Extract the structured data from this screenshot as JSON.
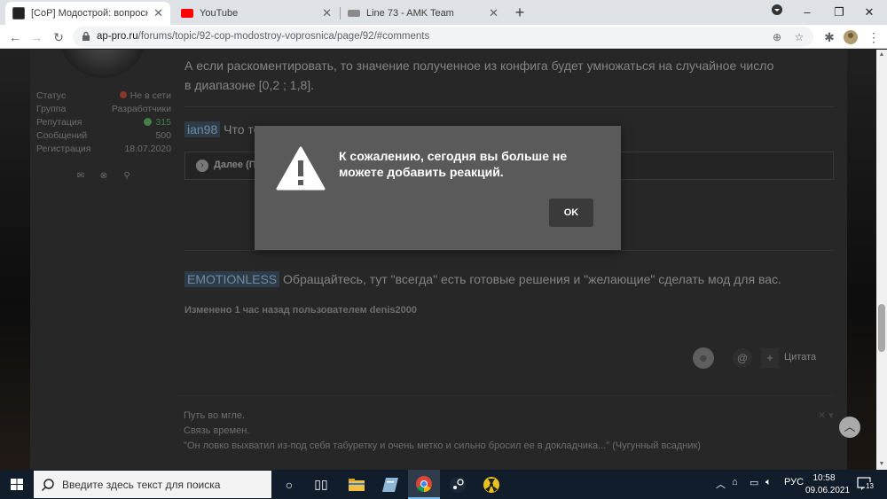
{
  "browser": {
    "tabs": [
      {
        "title": "[CoP] Модострой: вопросница",
        "active": true
      },
      {
        "title": "YouTube",
        "active": false
      },
      {
        "title": "Line 73 - AMK Team",
        "active": false
      }
    ],
    "url_host": "ap-pro.ru",
    "url_path": "/forums/topic/92-cop-modostroy-voprosnica/page/92/#comments",
    "window_controls": [
      "–",
      "❐",
      "✕"
    ]
  },
  "profile": {
    "stats": [
      {
        "key": "Статус",
        "value": "Не в сети"
      },
      {
        "key": "Группа",
        "value": "Разработчики"
      },
      {
        "key": "Репутация",
        "value": "315"
      },
      {
        "key": "Сообщений",
        "value": "500"
      },
      {
        "key": "Регистрация",
        "value": "18.07.2020"
      }
    ]
  },
  "post": {
    "line1": "А если раскоментировать, то значение полученное из конфига будет умножаться на случайное число",
    "line2": "в диапазоне [0,2 ; 1,8].",
    "mention1": "ian98",
    "mention1_text": "Что то",
    "next_label": "Далее (П",
    "mention2": "EMOTIONLESS",
    "mention2_text": "Обращайтесь, тут \"всегда\" есть готовые решения и \"желающие\" сделать мод для вас.",
    "edited": "Изменено 1 час назад пользователем denis2000",
    "quote_label": "Цитата",
    "signature": [
      "Путь во мгле.",
      "Связь времен.",
      "\"Он ловко выхватил из-под себя табуретку и очень метко и сильно бросил ее в докладчика...\" (Чугунный всадник)"
    ]
  },
  "dialog": {
    "message": "К сожалению, сегодня вы больше не можете добавить реакций.",
    "ok_label": "OK"
  },
  "taskbar": {
    "search_placeholder": "Введите здесь текст для поиска",
    "language": "РУС",
    "time": "10:58",
    "date": "09.06.2021",
    "notifications": "13"
  }
}
